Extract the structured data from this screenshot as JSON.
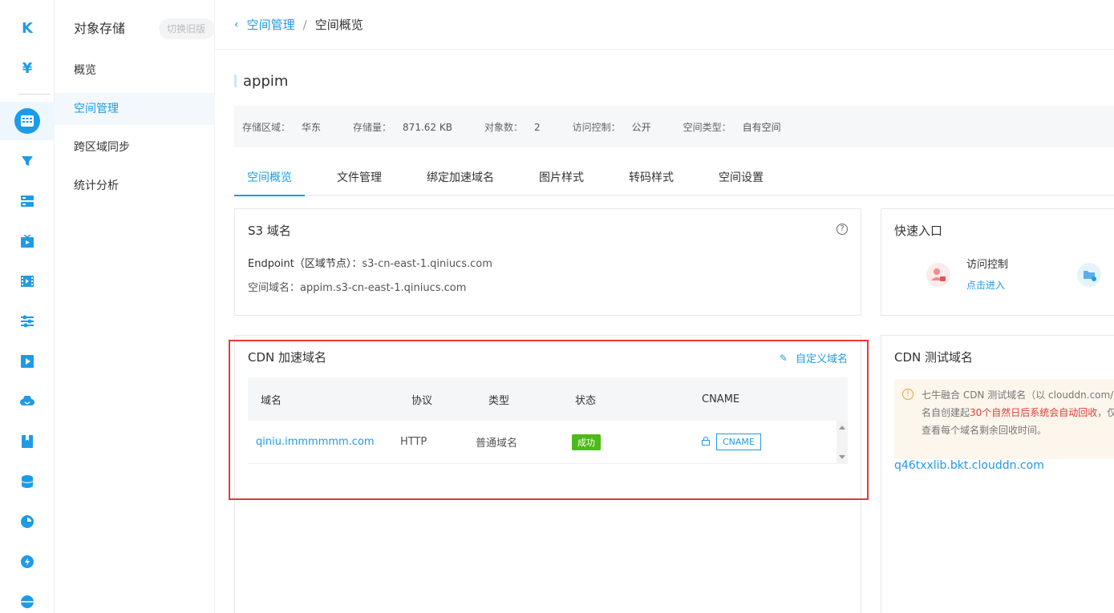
{
  "rail": {
    "icons": [
      "logo-icon",
      "yuan-icon",
      "grid-icon",
      "filter-icon",
      "server-icon",
      "tv-icon",
      "film-icon",
      "sliders-icon",
      "play-icon",
      "cloud-icon",
      "book-icon",
      "database-icon",
      "pie-icon",
      "power-icon",
      "globe-icon"
    ],
    "logo_text": "K",
    "yuan_text": "¥"
  },
  "subnav": {
    "title": "对象存储",
    "old_version": "切换旧版",
    "items": [
      "概览",
      "空间管理",
      "跨区域同步",
      "统计分析"
    ]
  },
  "breadcrumb": {
    "back": "‹",
    "parent": "空间管理",
    "separator": "/",
    "current": "空间概览"
  },
  "bucket": {
    "name": "appim",
    "info": [
      {
        "key": "存储区域：",
        "value": "华东"
      },
      {
        "key": "存储量：",
        "value": "871.62 KB"
      },
      {
        "key": "对象数：",
        "value": "2"
      },
      {
        "key": "访问控制：",
        "value": "公开"
      },
      {
        "key": "空间类型：",
        "value": "自有空间"
      }
    ]
  },
  "tabs": [
    "空间概览",
    "文件管理",
    "绑定加速域名",
    "图片样式",
    "转码样式",
    "空间设置"
  ],
  "s3": {
    "title": "S3 域名",
    "help": "?",
    "endpoint_key": "Endpoint（区域节点）：",
    "endpoint_value": "s3-cn-east-1.qiniucs.com",
    "domain_key": "空间域名：",
    "domain_value": "appim.s3-cn-east-1.qiniucs.com"
  },
  "quick": {
    "title": "快速入口",
    "item_label": "访问控制",
    "item_link": "点击进入"
  },
  "cdn": {
    "title": "CDN 加速域名",
    "custom_label": "自定义域名",
    "columns": [
      "域名",
      "协议",
      "类型",
      "状态",
      "CNAME"
    ],
    "rows": [
      {
        "domain": "qiniu.immmmmm.com",
        "protocol": "HTTP",
        "type": "普通域名",
        "status": "成功",
        "cname": "CNAME"
      }
    ]
  },
  "cdn_test": {
    "title": "CDN 测试域名",
    "notice_line1": "七牛融合 CDN 测试域名（以 clouddn.com/qi",
    "notice_line2_a": "名自创建起",
    "notice_line2_red": "30个自然日后系统会自动回收",
    "notice_line2_b": "，仅",
    "notice_line3": "查看每个域名剩余回收时间。",
    "domain": "q46txxlib.bkt.clouddn.com"
  },
  "colors": {
    "accent": "#1e9be6",
    "success": "#4cbb17",
    "highlight": "#e53935"
  }
}
